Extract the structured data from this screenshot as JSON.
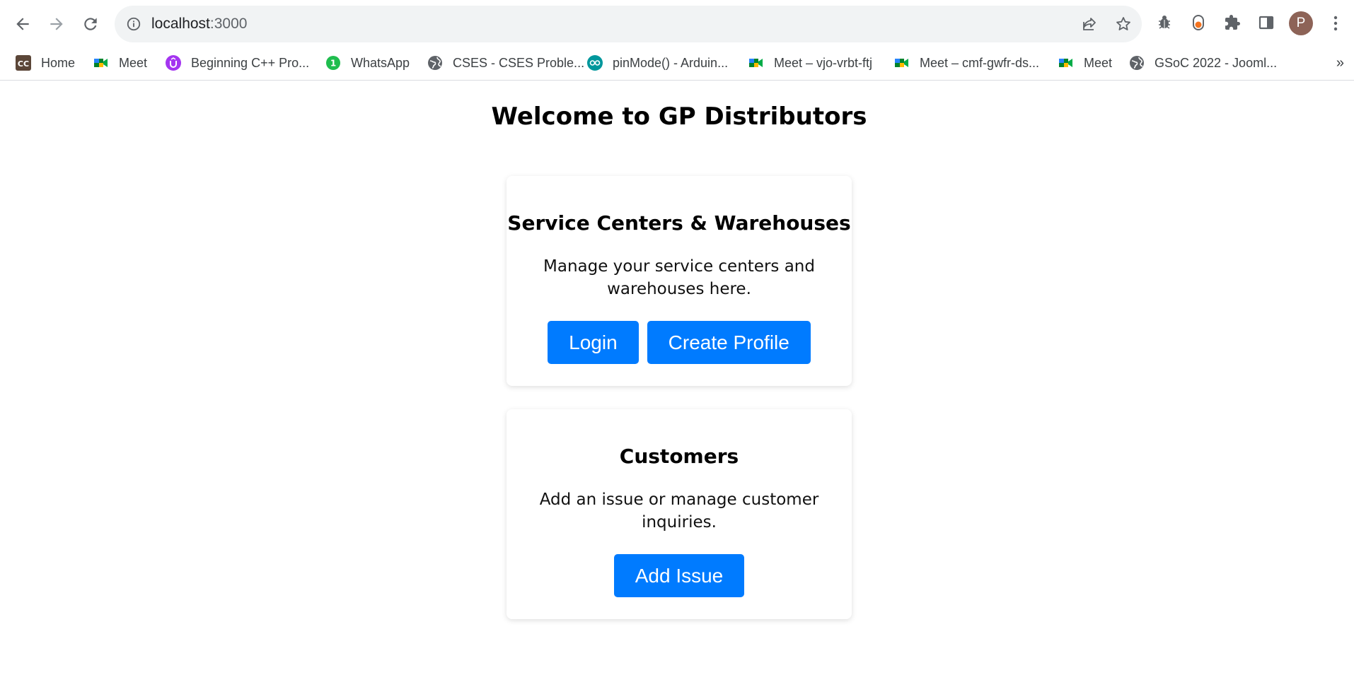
{
  "browser": {
    "url_host": "localhost",
    "url_port": ":3000",
    "profile_initial": "P",
    "bookmarks": [
      {
        "label": "Home",
        "icon": "codechef-icon"
      },
      {
        "label": "Meet",
        "icon": "google-meet-icon"
      },
      {
        "label": "Beginning C++ Pro...",
        "icon": "udemy-icon"
      },
      {
        "label": "WhatsApp",
        "icon": "whatsapp-icon"
      },
      {
        "label": "CSES - CSES Proble...",
        "icon": "globe-icon"
      },
      {
        "label": "pinMode() - Arduin...",
        "icon": "arduino-icon"
      },
      {
        "label": "Meet – vjo-vrbt-ftj",
        "icon": "google-meet-icon"
      },
      {
        "label": "Meet – cmf-gwfr-ds...",
        "icon": "google-meet-icon"
      },
      {
        "label": "Meet",
        "icon": "google-meet-icon"
      },
      {
        "label": "GSoC 2022 - Jooml...",
        "icon": "globe-icon"
      }
    ],
    "more_bookmarks": "»"
  },
  "page": {
    "title": "Welcome to GP Distributors",
    "cards": [
      {
        "heading": "Service Centers & Warehouses",
        "description": "Manage your service centers and warehouses here.",
        "buttons": [
          "Login",
          "Create Profile"
        ]
      },
      {
        "heading": "Customers",
        "description": "Add an issue or manage customer inquiries.",
        "buttons": [
          "Add Issue"
        ]
      }
    ]
  },
  "colors": {
    "primary_button": "#007bff",
    "avatar": "#8d6357"
  }
}
